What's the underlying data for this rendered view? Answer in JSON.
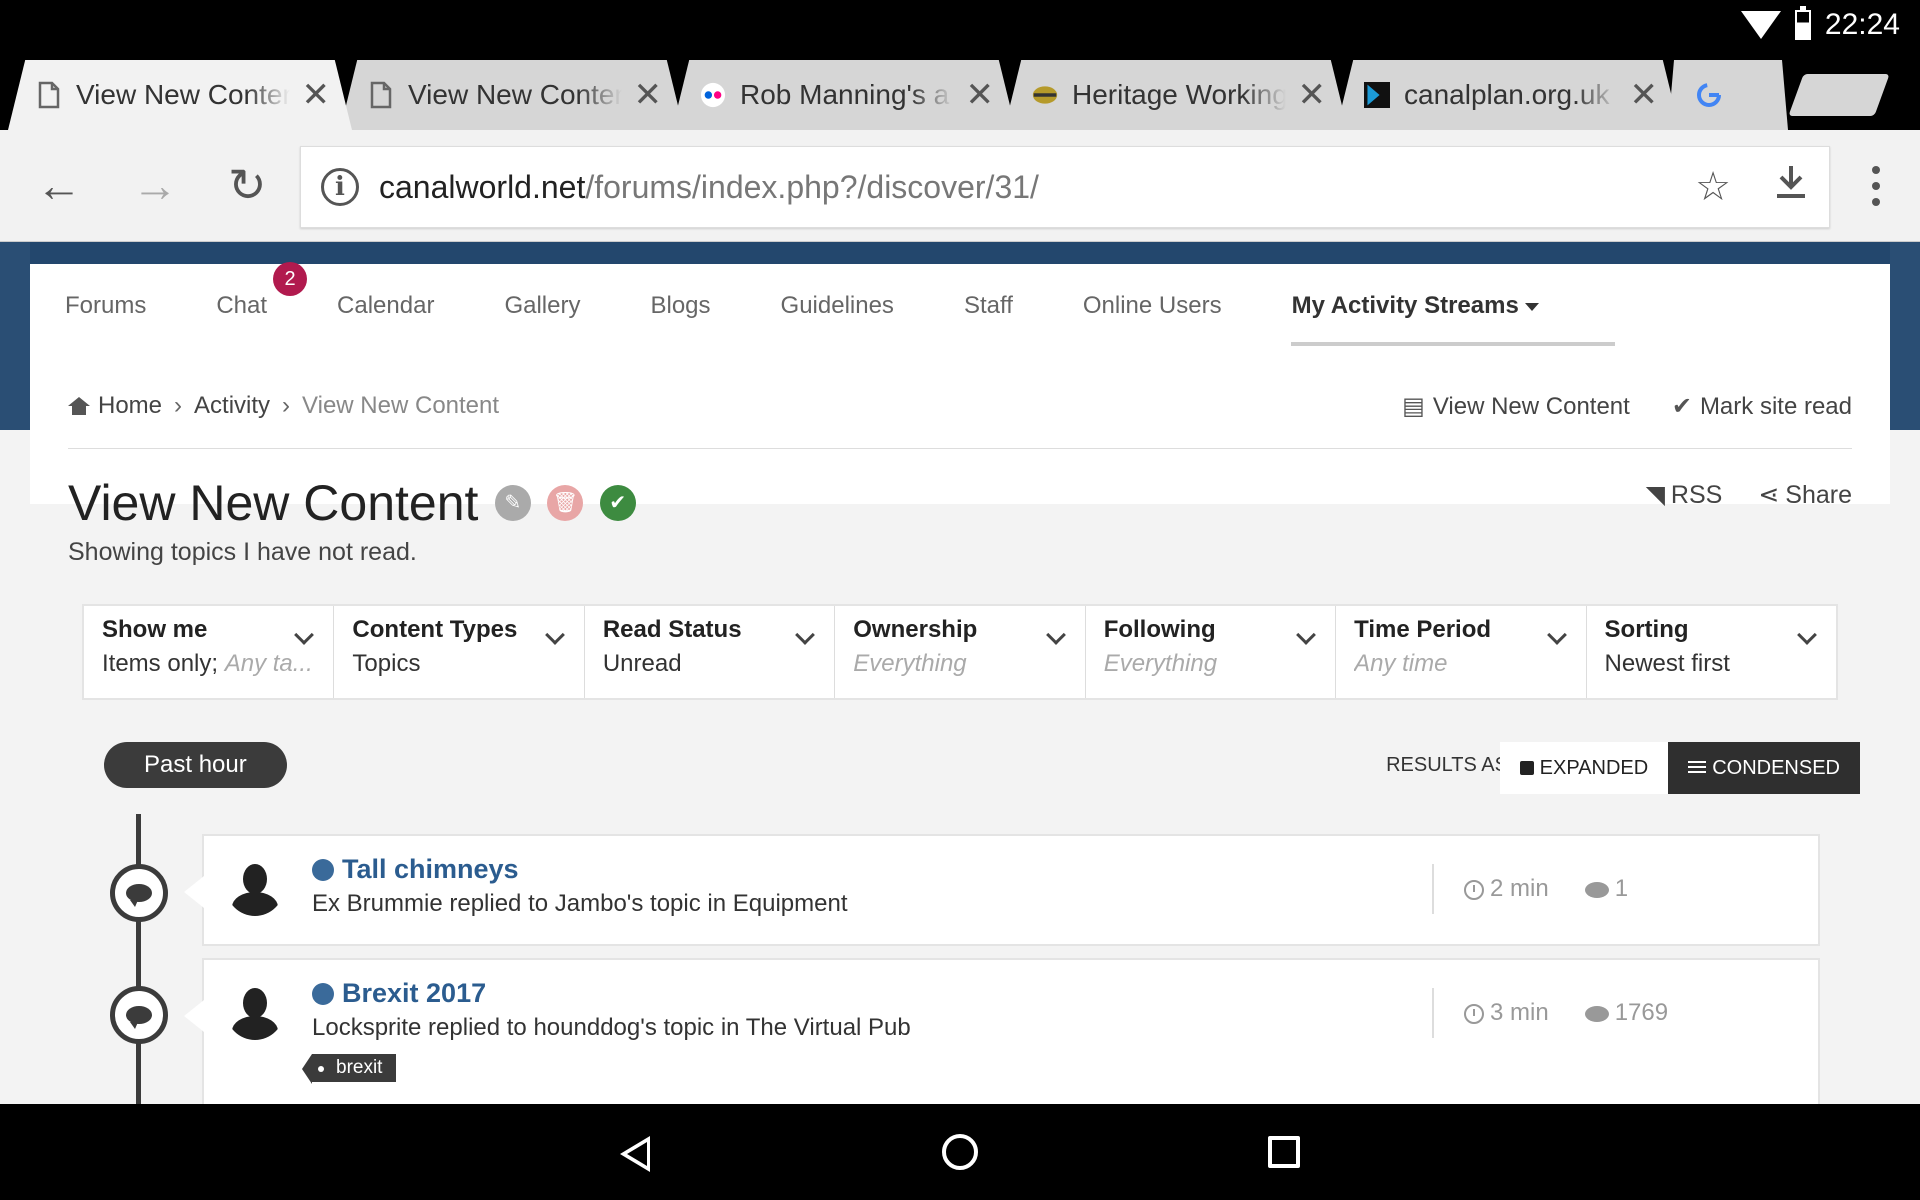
{
  "status_bar": {
    "time": "22:24"
  },
  "tabs": [
    {
      "title": "View New Content",
      "active": true
    },
    {
      "title": "View New Content",
      "active": false
    },
    {
      "title": "Rob Manning's a",
      "active": false
    },
    {
      "title": "Heritage Working",
      "active": false
    },
    {
      "title": "canalplan.org.uk",
      "active": false
    }
  ],
  "toolbar": {
    "url_host": "canalworld.net",
    "url_path": "/forums/index.php?/discover/31/"
  },
  "nav": {
    "items": [
      "Forums",
      "Chat",
      "Calendar",
      "Gallery",
      "Blogs",
      "Guidelines",
      "Staff",
      "Online Users",
      "My Activity Streams"
    ],
    "chat_badge": "2"
  },
  "breadcrumb": {
    "home": "Home",
    "activity": "Activity",
    "current": "View New Content"
  },
  "page_actions": {
    "view_new_content": "View New Content",
    "mark_site_read": "Mark site read",
    "rss": "RSS",
    "share": "Share"
  },
  "page": {
    "title": "View New Content",
    "subtitle": "Showing topics I have not read."
  },
  "filters": [
    {
      "label": "Show me",
      "value": "Items only;",
      "value_muted": "Any ta..."
    },
    {
      "label": "Content Types",
      "value": "Topics",
      "value_muted": ""
    },
    {
      "label": "Read Status",
      "value": "Unread",
      "value_muted": ""
    },
    {
      "label": "Ownership",
      "value": "",
      "value_muted": "Everything"
    },
    {
      "label": "Following",
      "value": "",
      "value_muted": "Everything"
    },
    {
      "label": "Time Period",
      "value": "",
      "value_muted": "Any time"
    },
    {
      "label": "Sorting",
      "value": "Newest first",
      "value_muted": ""
    }
  ],
  "stream": {
    "period": "Past hour",
    "results_as": "RESULTS AS",
    "expanded": "EXPANDED",
    "condensed": "CONDENSED",
    "items": [
      {
        "title": "Tall chimneys",
        "desc": "Ex Brummie replied to Jambo's topic in Equipment",
        "time": "2 min",
        "replies": "1",
        "tag": ""
      },
      {
        "title": "Brexit 2017",
        "desc": "Locksprite replied to hounddog's topic in The Virtual Pub",
        "time": "3 min",
        "replies": "1769",
        "tag": "brexit"
      }
    ]
  },
  "colors": {
    "header_blue": "#2a4e74",
    "link_blue": "#2b5c8f",
    "badge": "#b11a4e",
    "edit_icon": "#aaaaaa",
    "delete_icon": "#e8a6a6",
    "check_icon": "#3d8b40"
  }
}
